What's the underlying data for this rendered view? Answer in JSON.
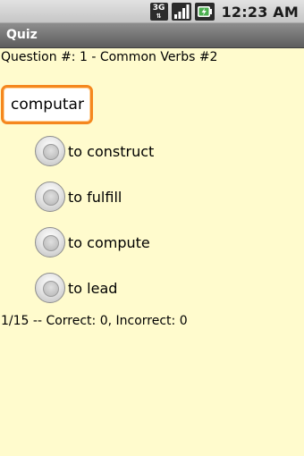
{
  "status_bar": {
    "network_label": "3G",
    "time": "12:23 AM",
    "icons": [
      "3g-data-icon",
      "signal-strength-icon",
      "battery-charging-icon"
    ]
  },
  "title_bar": {
    "title": "Quiz"
  },
  "question": {
    "header": "Question #: 1 - Common Verbs #2"
  },
  "answer_input": {
    "value": "computar"
  },
  "options": [
    {
      "label": "to construct"
    },
    {
      "label": "to fulfill"
    },
    {
      "label": "to compute"
    },
    {
      "label": "to lead"
    }
  ],
  "score": {
    "text": "1/15 -- Correct: 0, Incorrect: 0"
  },
  "colors": {
    "background": "#fffbcd",
    "title_bar": "#6e6e6e",
    "focus_border": "#f5871e"
  }
}
